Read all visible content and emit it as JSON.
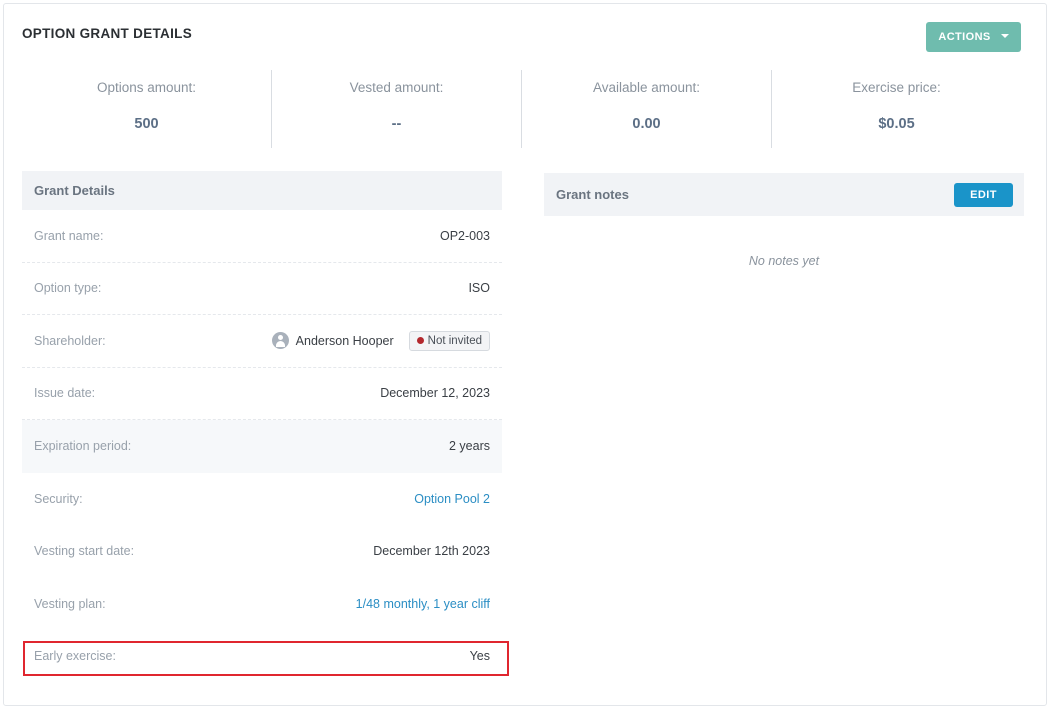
{
  "header": {
    "title": "OPTION GRANT DETAILS",
    "actions_label": "ACTIONS"
  },
  "stats": [
    {
      "label": "Options amount:",
      "value": "500"
    },
    {
      "label": "Vested amount:",
      "value": "--"
    },
    {
      "label": "Available amount:",
      "value": "0.00"
    },
    {
      "label": "Exercise price:",
      "value": "$0.05"
    }
  ],
  "grant_details": {
    "heading": "Grant Details",
    "grant_name": {
      "label": "Grant name:",
      "value": "OP2-003"
    },
    "option_type": {
      "label": "Option type:",
      "value": "ISO"
    },
    "shareholder": {
      "label": "Shareholder:",
      "name": "Anderson Hooper",
      "status": "Not invited",
      "status_color": "#b3282d"
    },
    "issue_date": {
      "label": "Issue date:",
      "value": "December 12, 2023"
    },
    "expiration_period": {
      "label": "Expiration period:",
      "value": "2 years"
    },
    "security": {
      "label": "Security:",
      "value": "Option Pool 2"
    },
    "vesting_start_date": {
      "label": "Vesting start date:",
      "value": "December 12th 2023"
    },
    "vesting_plan": {
      "label": "Vesting plan:",
      "value": "1/48 monthly, 1 year cliff"
    },
    "early_exercise": {
      "label": "Early exercise:",
      "value": "Yes"
    }
  },
  "grant_notes": {
    "heading": "Grant notes",
    "edit_label": "EDIT",
    "empty_text": "No notes yet"
  },
  "colors": {
    "actions_button": "#6fbcae",
    "edit_button": "#1a94c9",
    "link": "#2b8ec4",
    "highlight_border": "#e0262f"
  }
}
